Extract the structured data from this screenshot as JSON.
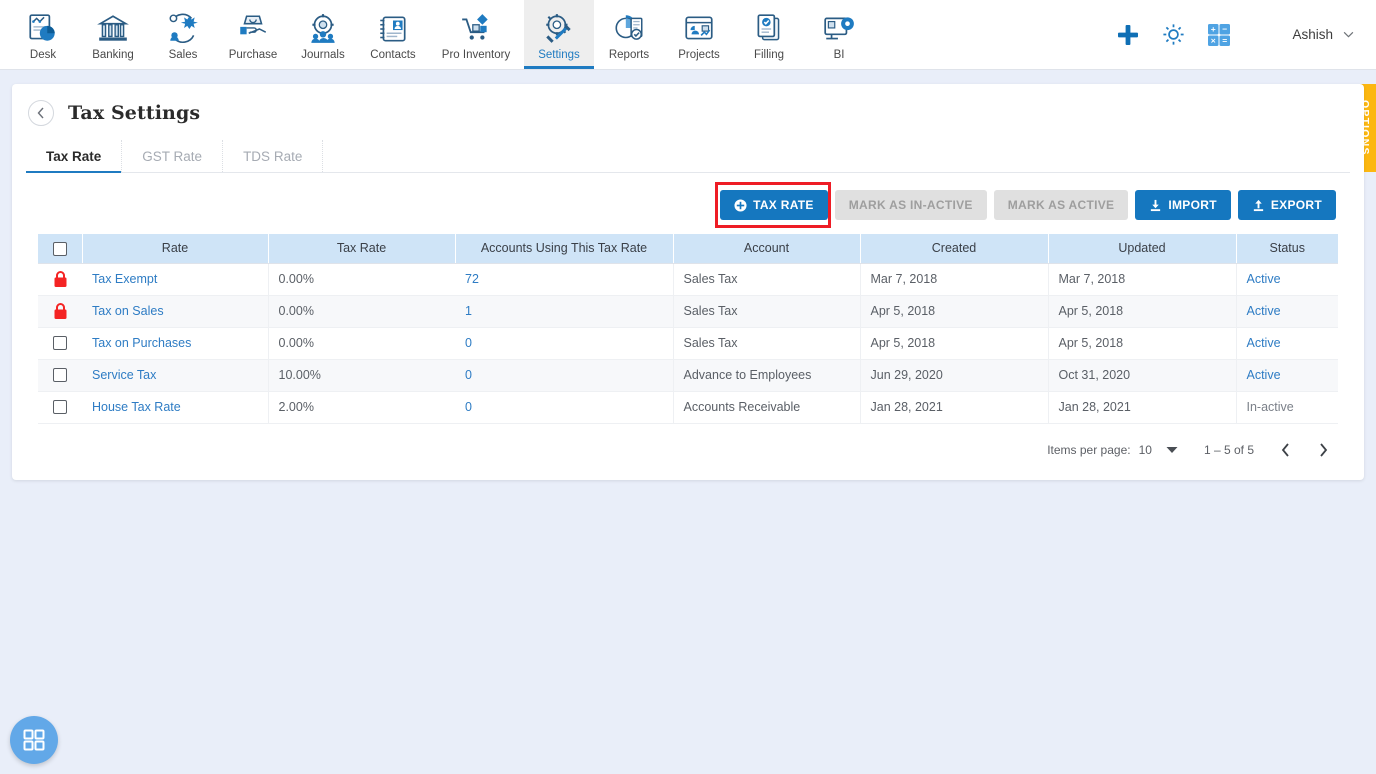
{
  "topnav": {
    "items": [
      {
        "label": "Desk",
        "icon": "desk-chart-icon"
      },
      {
        "label": "Banking",
        "icon": "bank-building-icon"
      },
      {
        "label": "Sales",
        "icon": "sales-gear-icon"
      },
      {
        "label": "Purchase",
        "icon": "purchase-bag-icon"
      },
      {
        "label": "Journals",
        "icon": "journals-people-gear-icon"
      },
      {
        "label": "Contacts",
        "icon": "contacts-card-icon"
      },
      {
        "label": "Pro Inventory",
        "icon": "inventory-cart-icon"
      },
      {
        "label": "Settings",
        "icon": "settings-tools-icon"
      },
      {
        "label": "Reports",
        "icon": "reports-pie-icon"
      },
      {
        "label": "Projects",
        "icon": "projects-board-icon"
      },
      {
        "label": "Filling",
        "icon": "filling-documents-icon"
      },
      {
        "label": "BI",
        "icon": "bi-monitor-icon"
      }
    ],
    "active_item": "Settings",
    "right": {
      "add_icon": "plus-icon",
      "settings_icon": "gear-icon",
      "calculator_icon": "calculator-icon",
      "user_name": "Ashish",
      "user_caret_icon": "chevron-down-icon"
    }
  },
  "page": {
    "back_icon": "chevron-left-icon",
    "title": "Tax Settings",
    "tabs": [
      {
        "label": "Tax Rate",
        "active": true
      },
      {
        "label": "GST Rate",
        "active": false
      },
      {
        "label": "TDS Rate",
        "active": false
      }
    ]
  },
  "toolbar": {
    "tax_rate_label": "TAX RATE",
    "tax_rate_icon": "plus-circle-icon",
    "mark_inactive_label": "MARK AS IN-ACTIVE",
    "mark_active_label": "MARK AS ACTIVE",
    "import_label": "IMPORT",
    "import_icon": "download-icon",
    "export_label": "EXPORT",
    "export_icon": "upload-icon",
    "highlight_color": "#ee1c25",
    "primary_color": "#1577bf"
  },
  "table": {
    "columns": [
      "Rate",
      "Tax Rate",
      "Accounts Using This Tax Rate",
      "Account",
      "Created",
      "Updated",
      "Status"
    ],
    "header_checkbox_icon": "checkbox-unchecked-icon",
    "rows": [
      {
        "selector": "lock",
        "rate": "Tax Exempt",
        "tax_rate": "0.00%",
        "accounts_using": "72",
        "account": "Sales Tax",
        "created": "Mar 7, 2018",
        "updated": "Mar 7, 2018",
        "status": "Active",
        "status_active": true
      },
      {
        "selector": "lock",
        "rate": "Tax on Sales",
        "tax_rate": "0.00%",
        "accounts_using": "1",
        "account": "Sales Tax",
        "created": "Apr 5, 2018",
        "updated": "Apr 5, 2018",
        "status": "Active",
        "status_active": true
      },
      {
        "selector": "checkbox",
        "rate": "Tax on Purchases",
        "tax_rate": "0.00%",
        "accounts_using": "0",
        "account": "Sales Tax",
        "created": "Apr 5, 2018",
        "updated": "Apr 5, 2018",
        "status": "Active",
        "status_active": true
      },
      {
        "selector": "checkbox",
        "rate": "Service Tax",
        "tax_rate": "10.00%",
        "accounts_using": "0",
        "account": "Advance to Employees",
        "created": "Jun 29, 2020",
        "updated": "Oct 31, 2020",
        "status": "Active",
        "status_active": true
      },
      {
        "selector": "checkbox",
        "rate": "House Tax Rate",
        "tax_rate": "2.00%",
        "accounts_using": "0",
        "account": "Accounts Receivable",
        "created": "Jan 28, 2021",
        "updated": "Jan 28, 2021",
        "status": "In-active",
        "status_active": false
      }
    ]
  },
  "pagination": {
    "items_per_page_label": "Items per page:",
    "items_per_page_value": "10",
    "range_label": "1 – 5 of 5",
    "prev_icon": "chevron-left-icon",
    "next_icon": "chevron-right-icon"
  },
  "options_tab": {
    "label": "OPTIONS",
    "color": "#fcb711"
  },
  "fab": {
    "icon": "grid-apps-icon",
    "color": "#62a8e8"
  }
}
